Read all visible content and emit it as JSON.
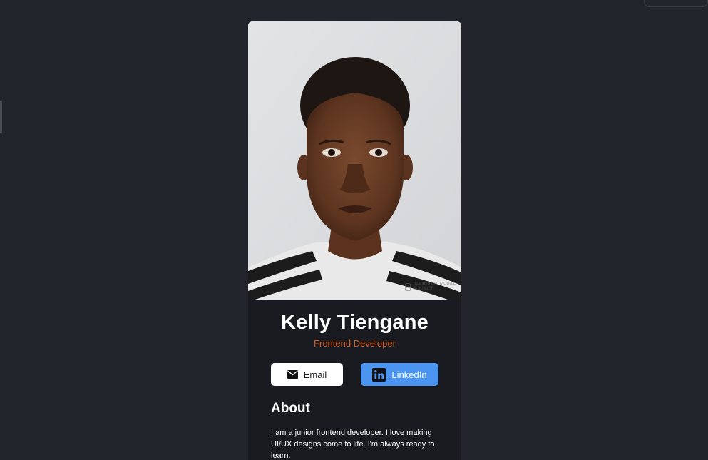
{
  "profile": {
    "name": "Kelly Tiengane",
    "role": "Frontend Developer",
    "photo_watermark": "Scanned with MOBILE SCANNER",
    "photo_watermark_badge": "m"
  },
  "buttons": {
    "email_label": "Email",
    "email_icon": "envelope-icon",
    "linkedin_label": "LinkedIn",
    "linkedin_icon": "linkedin-icon"
  },
  "about": {
    "title": "About",
    "text": "I am a junior frontend developer. I love making UI/UX designs come to life. I'm always ready to learn."
  },
  "colors": {
    "page_background": "#23252c",
    "card_background": "#1a1b21",
    "role_accent": "#d35b1f",
    "linkedin_button": "#4b95f0",
    "email_button": "#ffffff"
  }
}
